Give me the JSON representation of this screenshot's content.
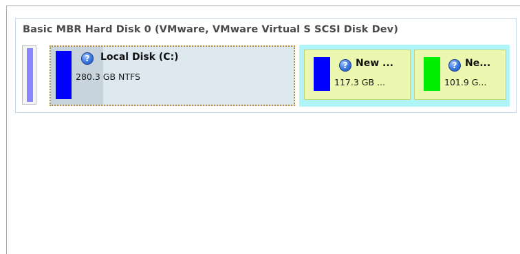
{
  "disk": {
    "title": "Basic MBR Hard Disk 0 (VMware, VMware Virtual S SCSI Disk Dev)",
    "disk_icon": "disk-usage-icon"
  },
  "partitions": {
    "c": {
      "name": "Local Disk (C:)",
      "size_prefix": "280.",
      "size_suffix": "3 GB NTFS",
      "color": "#0000ff",
      "icon": "help-icon"
    },
    "new1": {
      "name": "New ...",
      "size": "117.3 GB ...",
      "color": "#0000ff",
      "icon": "help-icon"
    },
    "new2": {
      "name": "Ne...",
      "size": "101.9 G...",
      "color": "#00ee00",
      "icon": "help-icon"
    }
  },
  "colors": {
    "extended_bg": "#aff5f7",
    "logical_bg": "#ecf7b0",
    "selected_bg": "#dde8ef",
    "selected_border": "#b58a2e",
    "disk_bar": "#8a86ff"
  }
}
